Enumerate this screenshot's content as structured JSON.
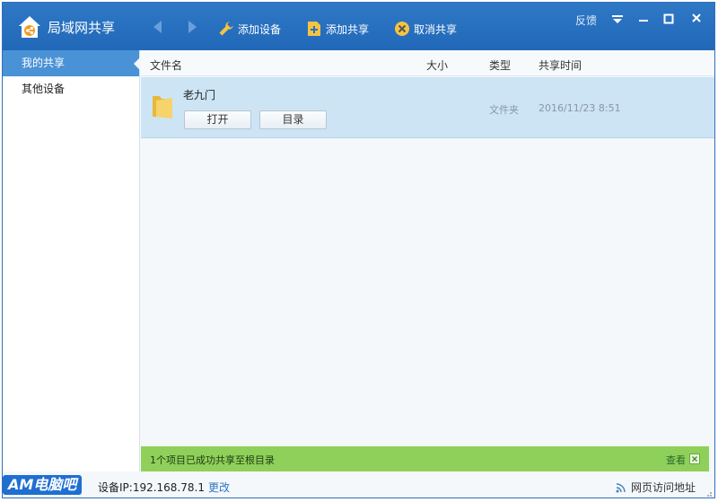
{
  "app": {
    "title": "局域网共享"
  },
  "toolbar": {
    "add_device": "添加设备",
    "add_share": "添加共享",
    "cancel_share": "取消共享",
    "feedback": "反馈"
  },
  "sidebar": {
    "items": [
      {
        "label": "我的共享",
        "active": true
      },
      {
        "label": "其他设备",
        "active": false
      }
    ]
  },
  "table": {
    "columns": {
      "name": "文件名",
      "size": "大小",
      "type": "类型",
      "time": "共享时间"
    },
    "rows": [
      {
        "name": "老九门",
        "size": "",
        "type": "文件夹",
        "time": "2016/11/23 8:51",
        "open_label": "打开",
        "dir_label": "目录"
      }
    ]
  },
  "notice": {
    "text": "1个项目已成功共享至根目录",
    "view": "查看"
  },
  "status": {
    "watermark": "AM电脑吧",
    "ip": "设备IP:192.168.78.1",
    "change": "更改",
    "web_address": "网页访问地址"
  },
  "colors": {
    "titlebar": "#2a70c0",
    "active_item": "#4a92d6",
    "selected_row": "#cde4f5",
    "notice_bar": "#8fd05a"
  }
}
